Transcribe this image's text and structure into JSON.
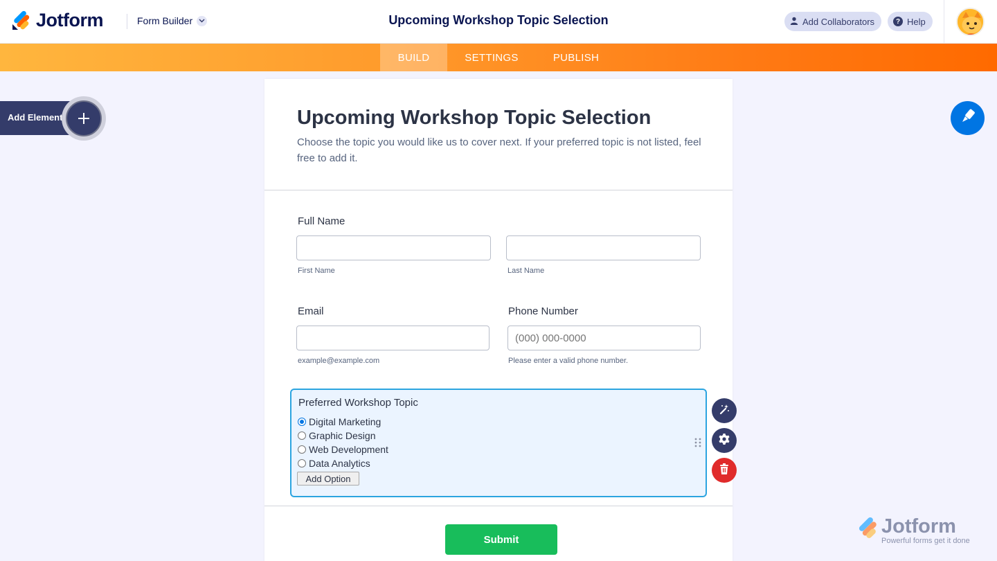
{
  "header": {
    "brand": "Jotform",
    "section": "Form Builder",
    "form_title": "Upcoming Workshop Topic Selection",
    "collaborators_label": "Add Collaborators",
    "help_label": "Help"
  },
  "nav": {
    "tabs": [
      {
        "label": "BUILD",
        "active": true
      },
      {
        "label": "SETTINGS"
      },
      {
        "label": "PUBLISH"
      }
    ]
  },
  "toolbar": {
    "add_element_label": "Add Element"
  },
  "form": {
    "title": "Upcoming Workshop Topic Selection",
    "description": "Choose the topic you would like us to cover next. If your preferred topic is not listed, feel free to add it.",
    "full_name": {
      "label": "Full Name",
      "first_sublabel": "First Name",
      "last_sublabel": "Last Name"
    },
    "email": {
      "label": "Email",
      "placeholder": "",
      "sublabel": "example@example.com"
    },
    "phone": {
      "label": "Phone Number",
      "placeholder": "(000) 000-0000",
      "sublabel": "Please enter a valid phone number."
    },
    "topic": {
      "label": "Preferred Workshop Topic",
      "options": [
        "Digital Marketing",
        "Graphic Design",
        "Web Development",
        "Data Analytics"
      ],
      "selected": "Digital Marketing",
      "add_option_label": "Add Option"
    },
    "submit_label": "Submit"
  },
  "watermark": {
    "brand": "Jotform",
    "tagline": "Powerful forms get it done"
  },
  "colors": {
    "brand_navy": "#0a1551",
    "nav_orange": "#ff7a14",
    "accent_blue": "#0075e3",
    "submit_green": "#18bd5b",
    "delete_red": "#e02b2b"
  },
  "icons": [
    "jotform-logo-icon",
    "chevron-down-icon",
    "user-icon",
    "help-icon",
    "avatar-icon",
    "plus-icon",
    "paint-brush-icon",
    "magic-wand-icon",
    "gear-icon",
    "trash-icon",
    "drag-handle-icon"
  ]
}
